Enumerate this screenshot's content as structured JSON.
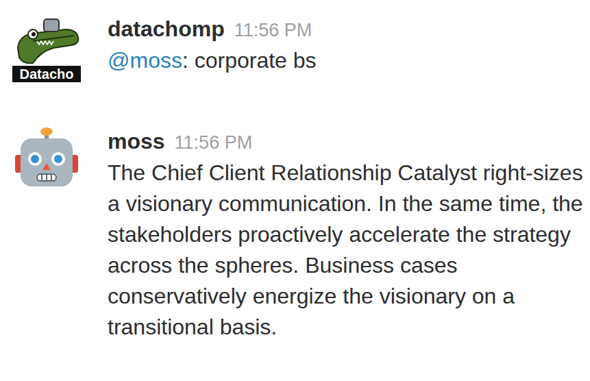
{
  "messages": [
    {
      "author": "datachomp",
      "time": "11:56 PM",
      "avatar_text": "Datacho",
      "parts": [
        {
          "text": "@moss",
          "kind": "mention"
        },
        {
          "text": ": corporate bs",
          "kind": "text"
        }
      ]
    },
    {
      "author": "moss",
      "time": "11:56 PM",
      "parts": [
        {
          "text": "The Chief Client Relationship Catalyst right-sizes a visionary communication. In the same time, the stakeholders proactively accelerate the strategy across the spheres. Business cases conservatively energize the visionary on a transitional basis.",
          "kind": "text"
        }
      ]
    }
  ]
}
